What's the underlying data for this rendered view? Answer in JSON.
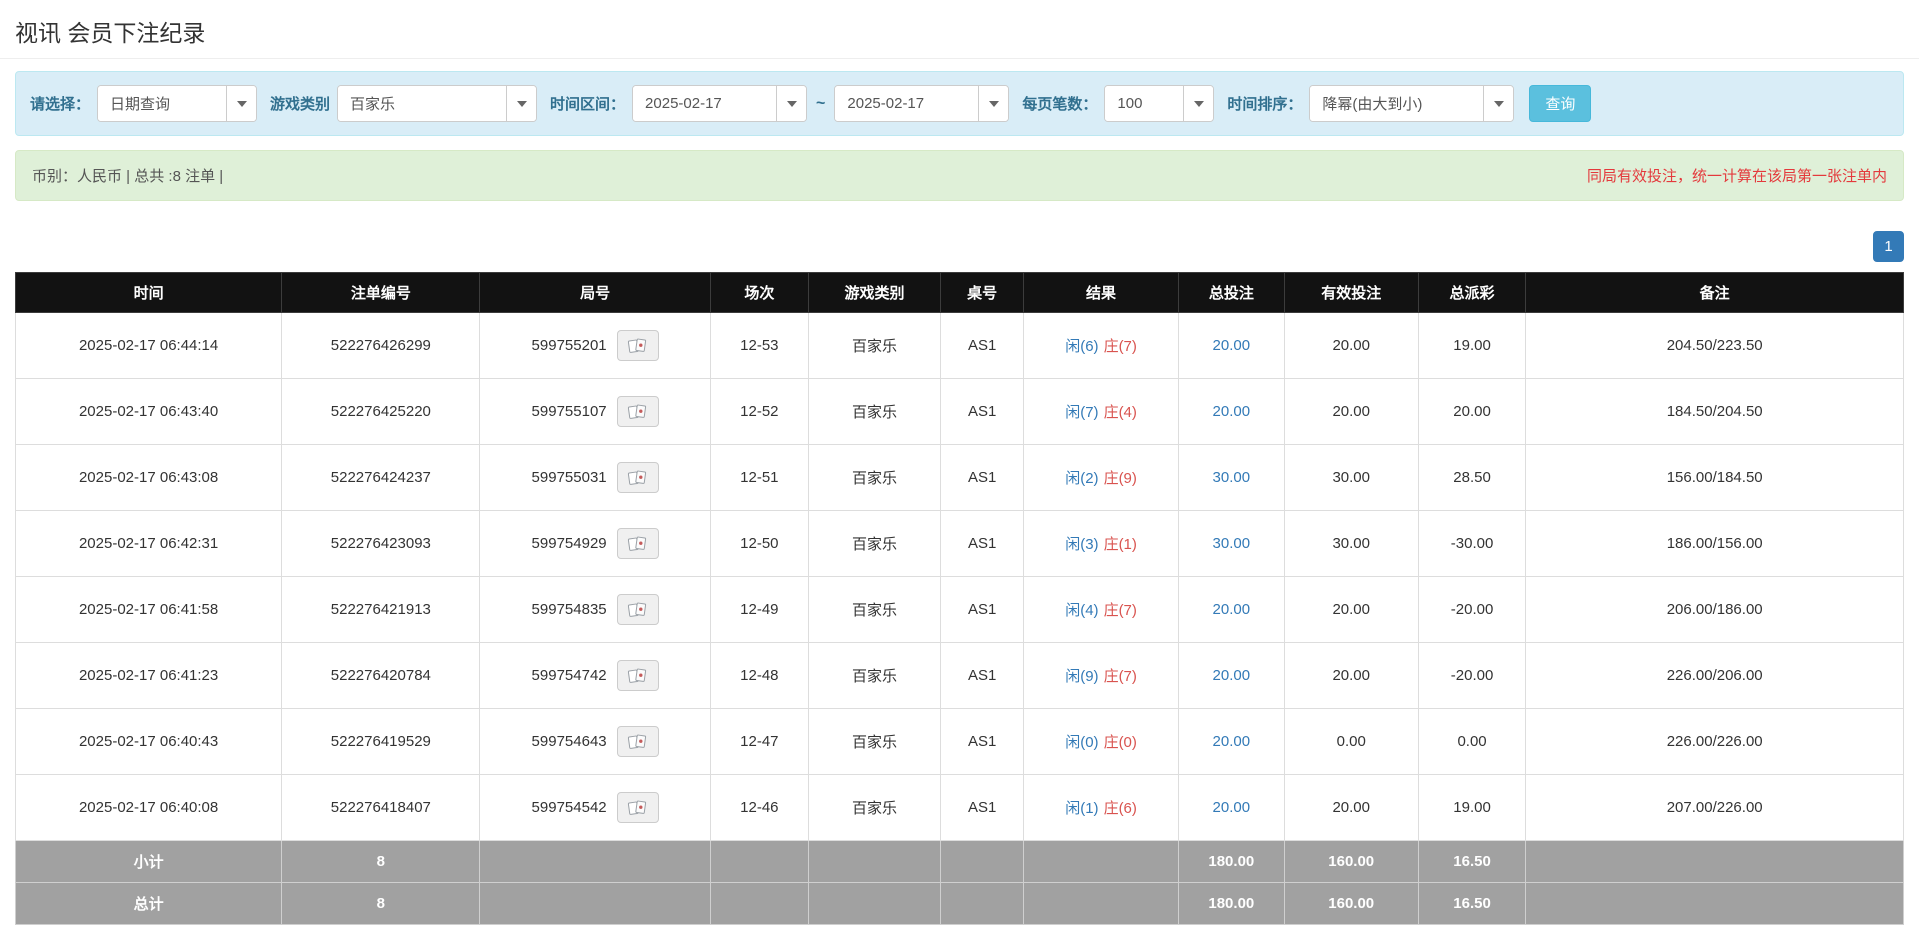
{
  "page_title": "视讯 会员下注纪录",
  "filter_bar": {
    "select_label": "请选择：",
    "select_value": "日期查询",
    "game_type_label": "游戏类别",
    "game_type_value": "百家乐",
    "time_range_label": "时间区间：",
    "date_from": "2025-02-17",
    "range_separator": "~",
    "date_to": "2025-02-17",
    "page_size_label": "每页笔数：",
    "page_size_value": "100",
    "sort_label": "时间排序：",
    "sort_value": "降幂(由大到小)",
    "search_button_label": "查询"
  },
  "summary_bar": {
    "left_text": "币别：人民币 | 总共 :8 注单 |",
    "right_text": "同局有效投注，统一计算在该局第一张注单内"
  },
  "pagination": {
    "current_page": "1"
  },
  "table": {
    "headers": [
      "时间",
      "注单编号",
      "局号",
      "场次",
      "游戏类别",
      "桌号",
      "结果",
      "总投注",
      "有效投注",
      "总派彩",
      "备注"
    ],
    "rows": [
      {
        "time": "2025-02-17 06:44:14",
        "bet_id": "522276426299",
        "round_id": "599755201",
        "session": "12-53",
        "game_type": "百家乐",
        "table_no": "AS1",
        "result_player": "闲(6)",
        "result_banker": "庄(7)",
        "total_bet": "20.00",
        "valid_bet": "20.00",
        "total_payout": "19.00",
        "remark": "204.50/223.50"
      },
      {
        "time": "2025-02-17 06:43:40",
        "bet_id": "522276425220",
        "round_id": "599755107",
        "session": "12-52",
        "game_type": "百家乐",
        "table_no": "AS1",
        "result_player": "闲(7)",
        "result_banker": "庄(4)",
        "total_bet": "20.00",
        "valid_bet": "20.00",
        "total_payout": "20.00",
        "remark": "184.50/204.50"
      },
      {
        "time": "2025-02-17 06:43:08",
        "bet_id": "522276424237",
        "round_id": "599755031",
        "session": "12-51",
        "game_type": "百家乐",
        "table_no": "AS1",
        "result_player": "闲(2)",
        "result_banker": "庄(9)",
        "total_bet": "30.00",
        "valid_bet": "30.00",
        "total_payout": "28.50",
        "remark": "156.00/184.50"
      },
      {
        "time": "2025-02-17 06:42:31",
        "bet_id": "522276423093",
        "round_id": "599754929",
        "session": "12-50",
        "game_type": "百家乐",
        "table_no": "AS1",
        "result_player": "闲(3)",
        "result_banker": "庄(1)",
        "total_bet": "30.00",
        "valid_bet": "30.00",
        "total_payout": "-30.00",
        "remark": "186.00/156.00"
      },
      {
        "time": "2025-02-17 06:41:58",
        "bet_id": "522276421913",
        "round_id": "599754835",
        "session": "12-49",
        "game_type": "百家乐",
        "table_no": "AS1",
        "result_player": "闲(4)",
        "result_banker": "庄(7)",
        "total_bet": "20.00",
        "valid_bet": "20.00",
        "total_payout": "-20.00",
        "remark": "206.00/186.00"
      },
      {
        "time": "2025-02-17 06:41:23",
        "bet_id": "522276420784",
        "round_id": "599754742",
        "session": "12-48",
        "game_type": "百家乐",
        "table_no": "AS1",
        "result_player": "闲(9)",
        "result_banker": "庄(7)",
        "total_bet": "20.00",
        "valid_bet": "20.00",
        "total_payout": "-20.00",
        "remark": "226.00/206.00"
      },
      {
        "time": "2025-02-17 06:40:43",
        "bet_id": "522276419529",
        "round_id": "599754643",
        "session": "12-47",
        "game_type": "百家乐",
        "table_no": "AS1",
        "result_player": "闲(0)",
        "result_banker": "庄(0)",
        "total_bet": "20.00",
        "valid_bet": "0.00",
        "total_payout": "0.00",
        "remark": "226.00/226.00"
      },
      {
        "time": "2025-02-17 06:40:08",
        "bet_id": "522276418407",
        "round_id": "599754542",
        "session": "12-46",
        "game_type": "百家乐",
        "table_no": "AS1",
        "result_player": "闲(1)",
        "result_banker": "庄(6)",
        "total_bet": "20.00",
        "valid_bet": "20.00",
        "total_payout": "19.00",
        "remark": "207.00/226.00"
      }
    ],
    "footer_rows": [
      {
        "label": "小计",
        "count": "8",
        "total_bet": "180.00",
        "valid_bet": "160.00",
        "total_payout": "16.50"
      },
      {
        "label": "总计",
        "count": "8",
        "total_bet": "180.00",
        "valid_bet": "160.00",
        "total_payout": "16.50"
      }
    ]
  },
  "colors": {
    "accent_blue": "#337ab7",
    "player_blue": "#337ab7",
    "banker_red": "#d9534f",
    "negative_red": "#e4393c",
    "warning_red": "#e4393c",
    "search_button_bg": "#5bc0de",
    "filter_bar_bg": "#d9edf7",
    "summary_bar_bg": "#dff0d8",
    "table_header_bg": "#121212",
    "table_footer_bg": "#a1a1a1"
  }
}
